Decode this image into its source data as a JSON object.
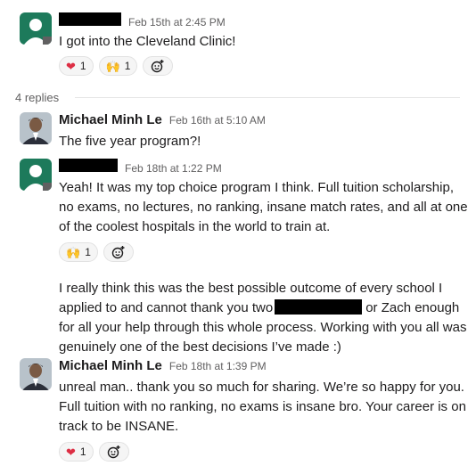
{
  "messages": [
    {
      "time": "Feb 15th at 2:45 PM",
      "text": "I got into the Cleveland Clinic!",
      "reactions": [
        {
          "emoji": "heart",
          "count": "1"
        },
        {
          "emoji": "raised-hands",
          "count": "1"
        }
      ]
    },
    {
      "author": "Michael Minh Le",
      "time": "Feb 16th at 5:10 AM",
      "text": "The five year program?!"
    },
    {
      "time": "Feb 18th at 1:22 PM",
      "text": "Yeah! It was my top choice program I think. Full tuition scholarship, no exams, no lectures, no ranking, insane match rates, and all at one of the coolest hospitals in the world to train at.",
      "reactions": [
        {
          "emoji": "raised-hands",
          "count": "1"
        }
      ],
      "followup_before": "I really think this was the best possible outcome of every school I applied to and cannot thank you two",
      "followup_after": "or Zach enough for all your help through this whole process. Working with you all was genuinely one of the best decisions I’ve made :)"
    },
    {
      "author": "Michael Minh Le",
      "time": "Feb 18th at 1:39 PM",
      "text": "unreal man.. thank you so much for sharing. We’re so happy for you. Full tuition with no ranking, no exams is insane bro. Your career is on track to be INSANE.",
      "reactions": [
        {
          "emoji": "heart",
          "count": "1"
        }
      ]
    }
  ],
  "thread": {
    "replies_label": "4 replies"
  },
  "colors": {
    "accent": "#1d7a5b",
    "heart": "#dd2e44",
    "hands": "#f2b330"
  }
}
